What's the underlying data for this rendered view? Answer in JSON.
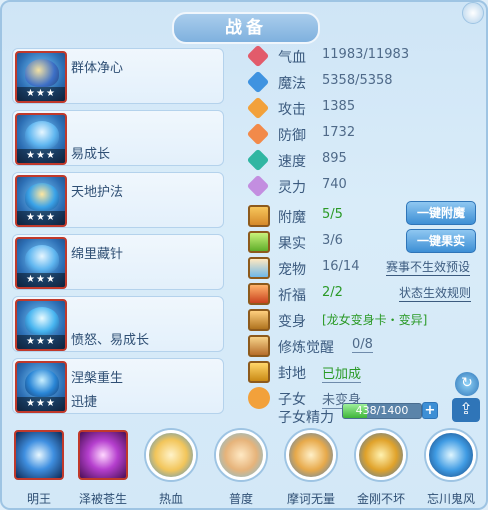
{
  "window": {
    "title": "战备"
  },
  "colors": {
    "accent": "#3d8fd5",
    "green": "#2b9a27",
    "border_red": "#c0392b"
  },
  "left_skills": [
    {
      "name": "群体净心",
      "stars": "★★★",
      "icon": "horse-swirl-icon"
    },
    {
      "name": "易成长",
      "stars": "★★★",
      "icon": "blue-dragon-icon"
    },
    {
      "name": "天地护法",
      "stars": "★★★",
      "icon": "guardian-icon"
    },
    {
      "name": "绵里藏针",
      "stars": "★★★",
      "icon": "needle-spirit-icon"
    },
    {
      "name": "愤怒、易成长",
      "stars": "★★★",
      "icon": "fury-spirit-icon"
    },
    {
      "name": "涅槃重生",
      "sub": "迅捷",
      "stars": "★★★",
      "icon": "rebirth-icon"
    }
  ],
  "attributes": [
    {
      "label": "气血",
      "value": "11983/11983",
      "icon": "heart-gem-icon",
      "color": "#e25b6b"
    },
    {
      "label": "魔法",
      "value": "5358/5358",
      "icon": "mana-gem-icon",
      "color": "#3f93e0"
    },
    {
      "label": "攻击",
      "value": "1385",
      "icon": "attack-gem-icon",
      "color": "#f2a13b"
    },
    {
      "label": "防御",
      "value": "1732",
      "icon": "defense-gem-icon",
      "color": "#f28a4a"
    },
    {
      "label": "速度",
      "value": "895",
      "icon": "speed-gem-icon",
      "color": "#30b6a2"
    },
    {
      "label": "灵力",
      "value": "740",
      "icon": "spirit-gem-icon",
      "color": "#c38ee0"
    }
  ],
  "extras": {
    "fumo": {
      "label": "附魔",
      "value": "5/5"
    },
    "guoshi": {
      "label": "果实",
      "value": "3/6"
    },
    "chongwu": {
      "label": "宠物",
      "value": "16/14",
      "link": "赛事不生效预设"
    },
    "qifu": {
      "label": "祈福",
      "value": "2/2",
      "link": "状态生效规则"
    },
    "bianshen": {
      "label": "变身",
      "value": "[龙女变身卡・变异]"
    },
    "xiulian": {
      "label": "修炼觉醒",
      "value": "0/8"
    },
    "fengdi": {
      "label": "封地",
      "value": "已加成"
    },
    "zinv": {
      "label": "子女",
      "value": "未变身"
    },
    "zinv_jingli": {
      "label": "子女精力",
      "value": "438/1400",
      "fraction": 0.313
    }
  },
  "buttons": {
    "fumo": "一键附魔",
    "guoshi": "一键果实",
    "plus": "+",
    "share": "⇪",
    "refresh": "↻"
  },
  "bottom_skills": [
    {
      "name": "明王",
      "icon": "ming-wang-icon",
      "shape": "square"
    },
    {
      "name": "泽被苍生",
      "icon": "blessing-icon",
      "shape": "square"
    },
    {
      "name": "热血",
      "icon": "hot-blood-icon",
      "shape": "round"
    },
    {
      "name": "普度",
      "icon": "salvation-hand-icon",
      "shape": "round"
    },
    {
      "name": "摩诃无量",
      "icon": "mahe-icon",
      "shape": "round"
    },
    {
      "name": "金刚不坏",
      "icon": "vajra-icon",
      "shape": "round"
    },
    {
      "name": "忘川鬼风",
      "icon": "ghost-wind-icon",
      "shape": "round"
    }
  ]
}
